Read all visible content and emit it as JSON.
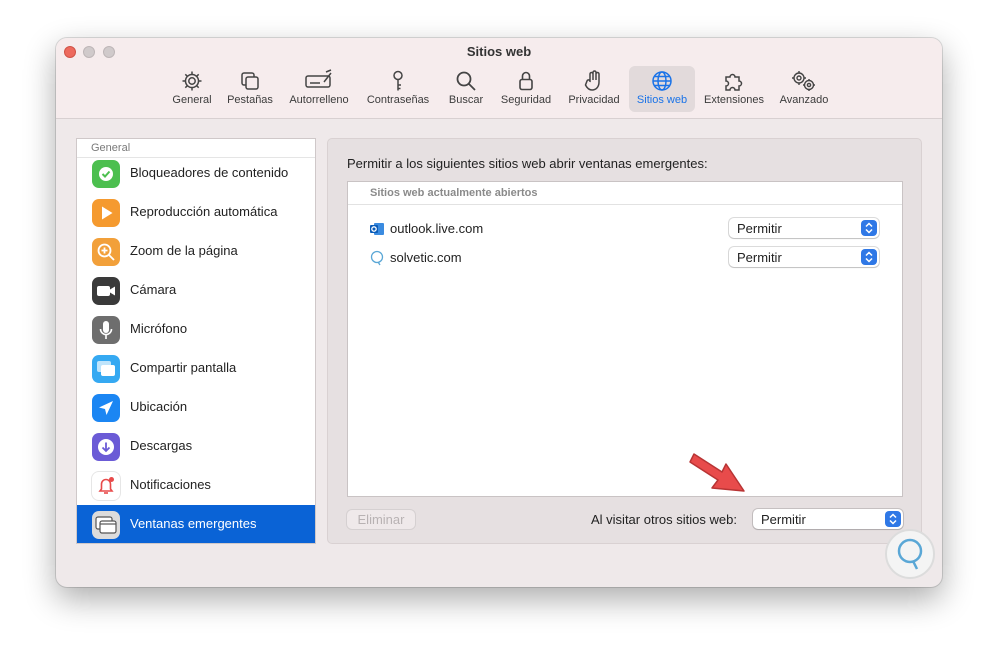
{
  "window": {
    "title": "Sitios web"
  },
  "toolbar": {
    "items": [
      {
        "label": "General",
        "icon": "gear-icon"
      },
      {
        "label": "Pestañas",
        "icon": "tabs-icon"
      },
      {
        "label": "Autorrelleno",
        "icon": "autofill-icon"
      },
      {
        "label": "Contraseñas",
        "icon": "key-icon"
      },
      {
        "label": "Buscar",
        "icon": "search-icon"
      },
      {
        "label": "Seguridad",
        "icon": "lock-icon"
      },
      {
        "label": "Privacidad",
        "icon": "hand-icon"
      },
      {
        "label": "Sitios web",
        "icon": "globe-icon",
        "active": true
      },
      {
        "label": "Extensiones",
        "icon": "puzzle-icon"
      },
      {
        "label": "Avanzado",
        "icon": "gears-icon"
      }
    ]
  },
  "sidebar": {
    "header": "General",
    "items": [
      {
        "label": "Bloqueadores de contenido",
        "icon": "checkmark-shield-icon",
        "color": "#4cbf4f"
      },
      {
        "label": "Reproducción automática",
        "icon": "play-icon",
        "color": "#f59a2f"
      },
      {
        "label": "Zoom de la página",
        "icon": "zoom-icon",
        "color": "#f2a03a"
      },
      {
        "label": "Cámara",
        "icon": "camera-icon",
        "color": "#3a3a3a"
      },
      {
        "label": "Micrófono",
        "icon": "microphone-icon",
        "color": "#6e6e6e"
      },
      {
        "label": "Compartir pantalla",
        "icon": "screen-share-icon",
        "color": "#35a9f2"
      },
      {
        "label": "Ubicación",
        "icon": "location-icon",
        "color": "#1b86f3"
      },
      {
        "label": "Descargas",
        "icon": "download-icon",
        "color": "#6b5bd6"
      },
      {
        "label": "Notificaciones",
        "icon": "bell-icon",
        "color": "#e84a4a"
      },
      {
        "label": "Ventanas emergentes",
        "icon": "popup-window-icon",
        "color": "#dcdcdc",
        "active": true
      }
    ]
  },
  "main": {
    "title": "Permitir a los siguientes sitios web abrir ventanas emergentes:",
    "table_header": "Sitios web actualmente abiertos",
    "sites": [
      {
        "domain": "outlook.live.com",
        "setting": "Permitir",
        "icon": "outlook-icon"
      },
      {
        "domain": "solvetic.com",
        "setting": "Permitir",
        "icon": "solvetic-icon"
      }
    ],
    "delete_label": "Eliminar",
    "other_sites_label": "Al visitar otros sitios web:",
    "other_sites_value": "Permitir"
  },
  "colors": {
    "accent": "#0a63d6",
    "annotation_arrow": "#e84b4b"
  }
}
